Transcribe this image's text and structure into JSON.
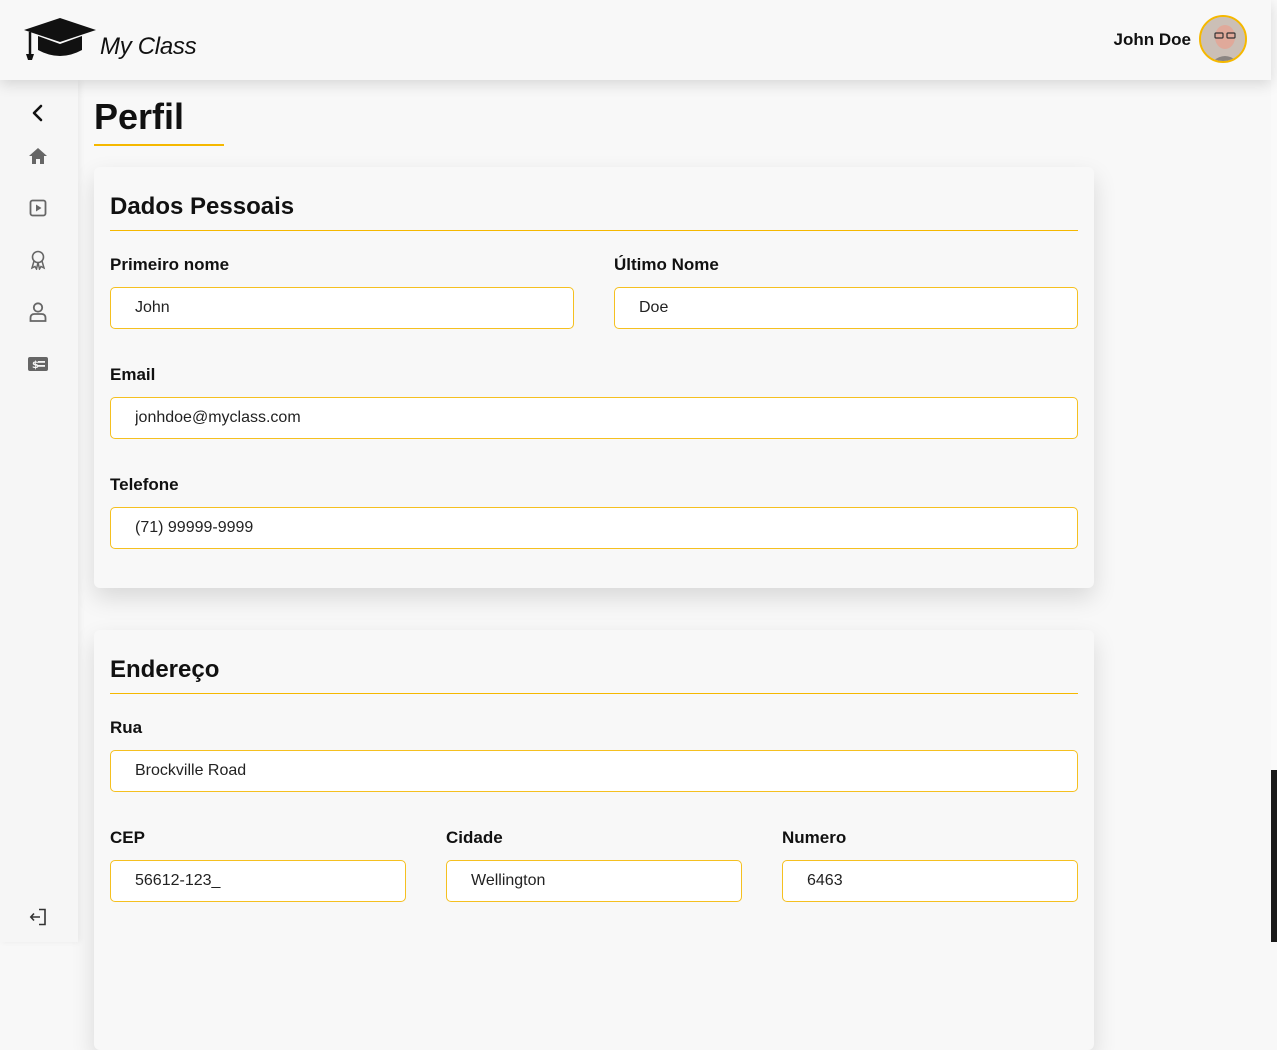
{
  "app": {
    "name": "My Class"
  },
  "user": {
    "name": "John Doe"
  },
  "sidebar": {
    "items": [
      {
        "icon": "chevron-left-icon"
      },
      {
        "icon": "home-icon"
      },
      {
        "icon": "play-square-icon"
      },
      {
        "icon": "award-ribbon-icon"
      },
      {
        "icon": "user-icon"
      },
      {
        "icon": "money-card-icon"
      },
      {
        "icon": "logout-icon"
      }
    ]
  },
  "page": {
    "title": "Perfil"
  },
  "personal": {
    "title": "Dados Pessoais",
    "first_name_label": "Primeiro nome",
    "first_name": "John",
    "last_name_label": "Último Nome",
    "last_name": "Doe",
    "email_label": "Email",
    "email": "jonhdoe@myclass.com",
    "phone_label": "Telefone",
    "phone": "(71) 99999-9999"
  },
  "address": {
    "title": "Endereço",
    "street_label": "Rua",
    "street": "Brockville Road",
    "cep_label": "CEP",
    "cep": "56612-123_",
    "city_label": "Cidade",
    "city": "Wellington",
    "number_label": "Numero",
    "number": "6463"
  },
  "colors": {
    "accent": "#f5b800",
    "background": "#f8f8f8"
  }
}
